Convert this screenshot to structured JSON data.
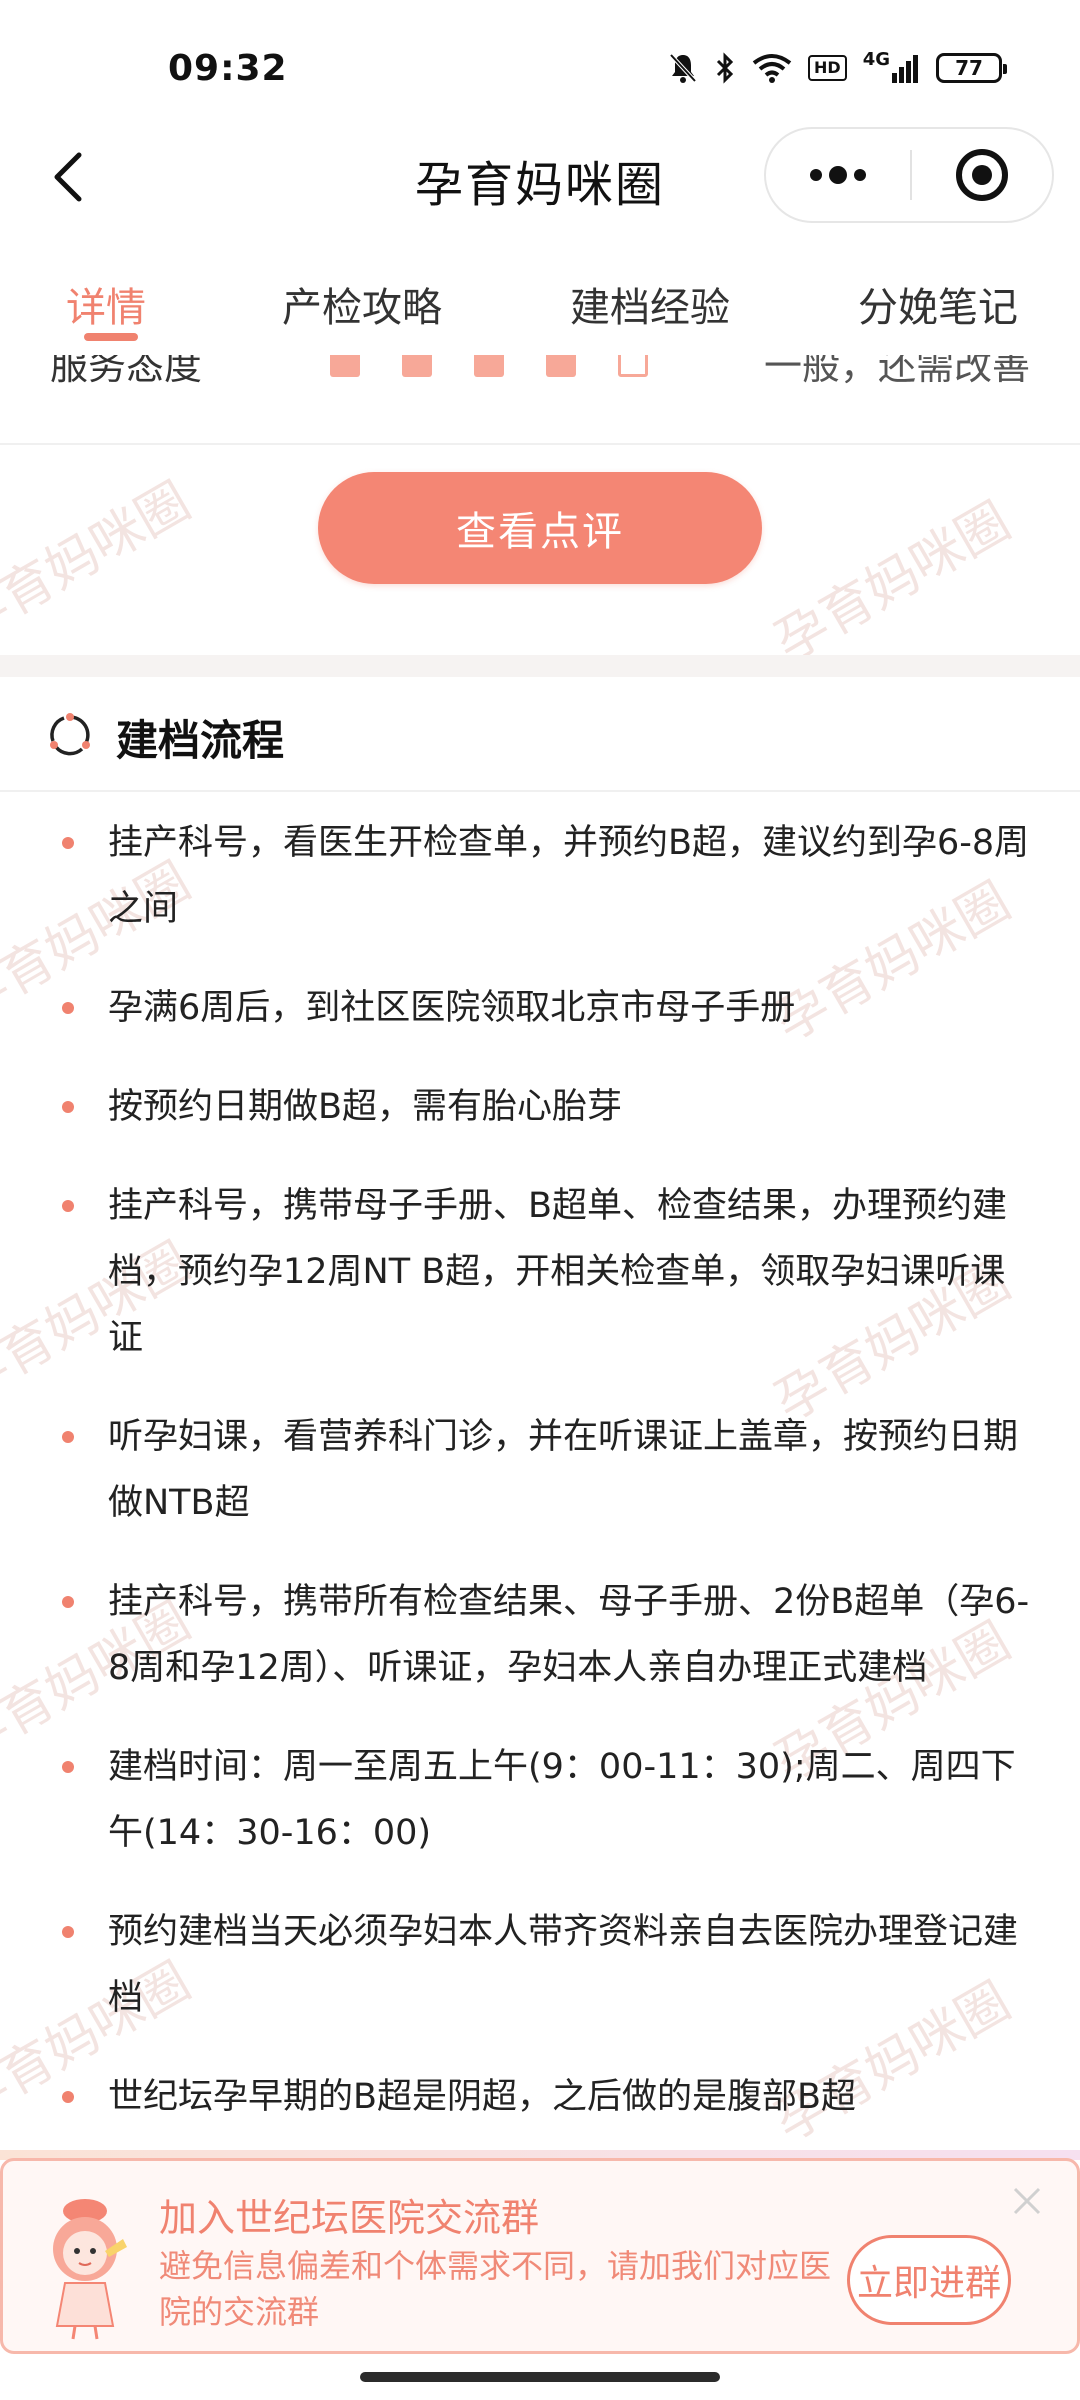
{
  "status_bar": {
    "time": "09:32",
    "battery": "77",
    "hd": "HD",
    "network": "4G"
  },
  "nav": {
    "title": "孕育妈咪圈"
  },
  "tabs": [
    {
      "label": "详情",
      "active": true
    },
    {
      "label": "产检攻略",
      "active": false
    },
    {
      "label": "建档经验",
      "active": false
    },
    {
      "label": "分娩笔记",
      "active": false
    }
  ],
  "service_rating": {
    "label": "服务态度",
    "filled": 4,
    "total": 5,
    "result": "一般，还需改善"
  },
  "review_button": {
    "label": "查看点评"
  },
  "section": {
    "title": "建档流程"
  },
  "steps": [
    "挂产科号，看医生开检查单，并预约B超，建议约到孕6-8周之间",
    "孕满6周后，到社区医院领取北京市母子手册",
    "按预约日期做B超，需有胎心胎芽",
    "挂产科号，携带母子手册、B超单、检查结果，办理预约建档，预约孕12周NT B超，开相关检查单，领取孕妇课听课证",
    "听孕妇课，看营养科门诊，并在听课证上盖章，按预约日期做NTB超",
    "挂产科号，携带所有检查结果、母子手册、2份B超单（孕6-8周和孕12周）、听课证，孕妇本人亲自办理正式建档",
    "建档时间：周一至周五上午(9：00-11：30);周二、周四下午(14：30-16：00)",
    "预约建档当天必须孕妇本人带齐资料亲自去医院办理登记建档",
    "世纪坛孕早期的B超是阴超，之后做的是腹部B超"
  ],
  "watermark": "孕育妈咪圈",
  "banner": {
    "title": "加入世纪坛医院交流群",
    "description": "避免信息偏差和个体需求不同，请加我们对应医院的交流群",
    "join_label": "立即进群",
    "close_label": "X"
  },
  "colors": {
    "accent": "#f0826f",
    "button": "#f48674",
    "watermark": "#f3e4e1"
  }
}
